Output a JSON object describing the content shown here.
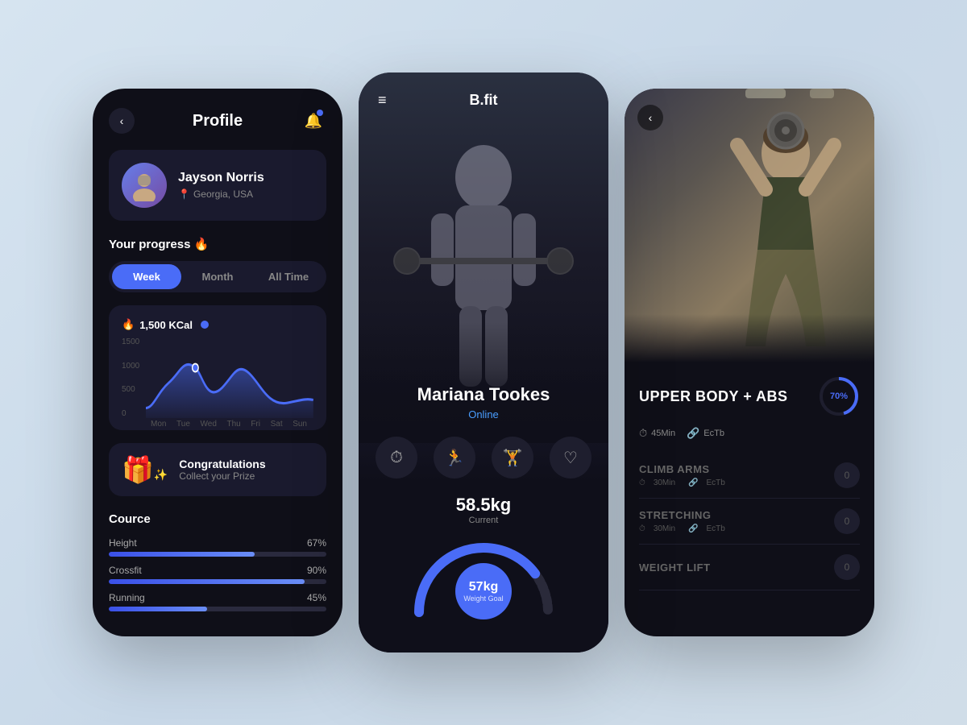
{
  "background": {
    "color": "#c8d8e8"
  },
  "leftPhone": {
    "header": {
      "title": "Profile",
      "backLabel": "‹",
      "notifIcon": "🔔"
    },
    "profile": {
      "name": "Jayson Norris",
      "location": "Georgia, USA",
      "avatarEmoji": "👤"
    },
    "progress": {
      "title": "Your progress 🔥",
      "tabs": [
        "Week",
        "Month",
        "All Time"
      ],
      "activeTab": 0,
      "kcal": "1,500 KCal",
      "yLabels": [
        "1500",
        "1000",
        "500",
        "0"
      ],
      "xLabels": [
        "Mon",
        "Tue",
        "Wed",
        "Thu",
        "Fri",
        "Sat",
        "Sun"
      ]
    },
    "congrats": {
      "title": "Congratulations",
      "subtitle": "Collect your Prize",
      "icon": "🎁"
    },
    "course": {
      "title": "Cource",
      "items": [
        {
          "label": "Height",
          "pct": 67,
          "pctLabel": "67%"
        },
        {
          "label": "Crossfit",
          "pct": 90,
          "pctLabel": "90%"
        },
        {
          "label": "Running",
          "pct": 45,
          "pctLabel": "45%"
        }
      ]
    }
  },
  "centerPhone": {
    "header": {
      "menuIcon": "≡",
      "title": "B.fit"
    },
    "trainer": {
      "name": "Mariana Tookes",
      "status": "Online"
    },
    "icons": [
      "⏱",
      "🏃",
      "🏋",
      "❤"
    ],
    "weight": {
      "value": "58.5kg",
      "label": "Current",
      "goalValue": "57kg",
      "goalLabel": "Weight Goal"
    }
  },
  "rightPhone": {
    "backLabel": "‹",
    "workoutTitle": "UPPER BODY + ABS",
    "progressPct": "70%",
    "progressValue": 70,
    "meta": [
      {
        "icon": "⏱",
        "label": "45Min"
      },
      {
        "icon": "🔗",
        "label": "EcTb"
      }
    ],
    "exercises": [
      {
        "name": "CLIMB ARMS",
        "meta": [
          {
            "icon": "⏱",
            "label": "30Min"
          },
          {
            "icon": "🔗",
            "label": "EcTb"
          }
        ],
        "count": "0"
      },
      {
        "name": "STRETCHING",
        "meta": [
          {
            "icon": "⏱",
            "label": "30Min"
          },
          {
            "icon": "🔗",
            "label": "EcTb"
          }
        ],
        "count": "0"
      },
      {
        "name": "WEIGHT LIFT",
        "meta": [],
        "count": "0"
      }
    ]
  }
}
